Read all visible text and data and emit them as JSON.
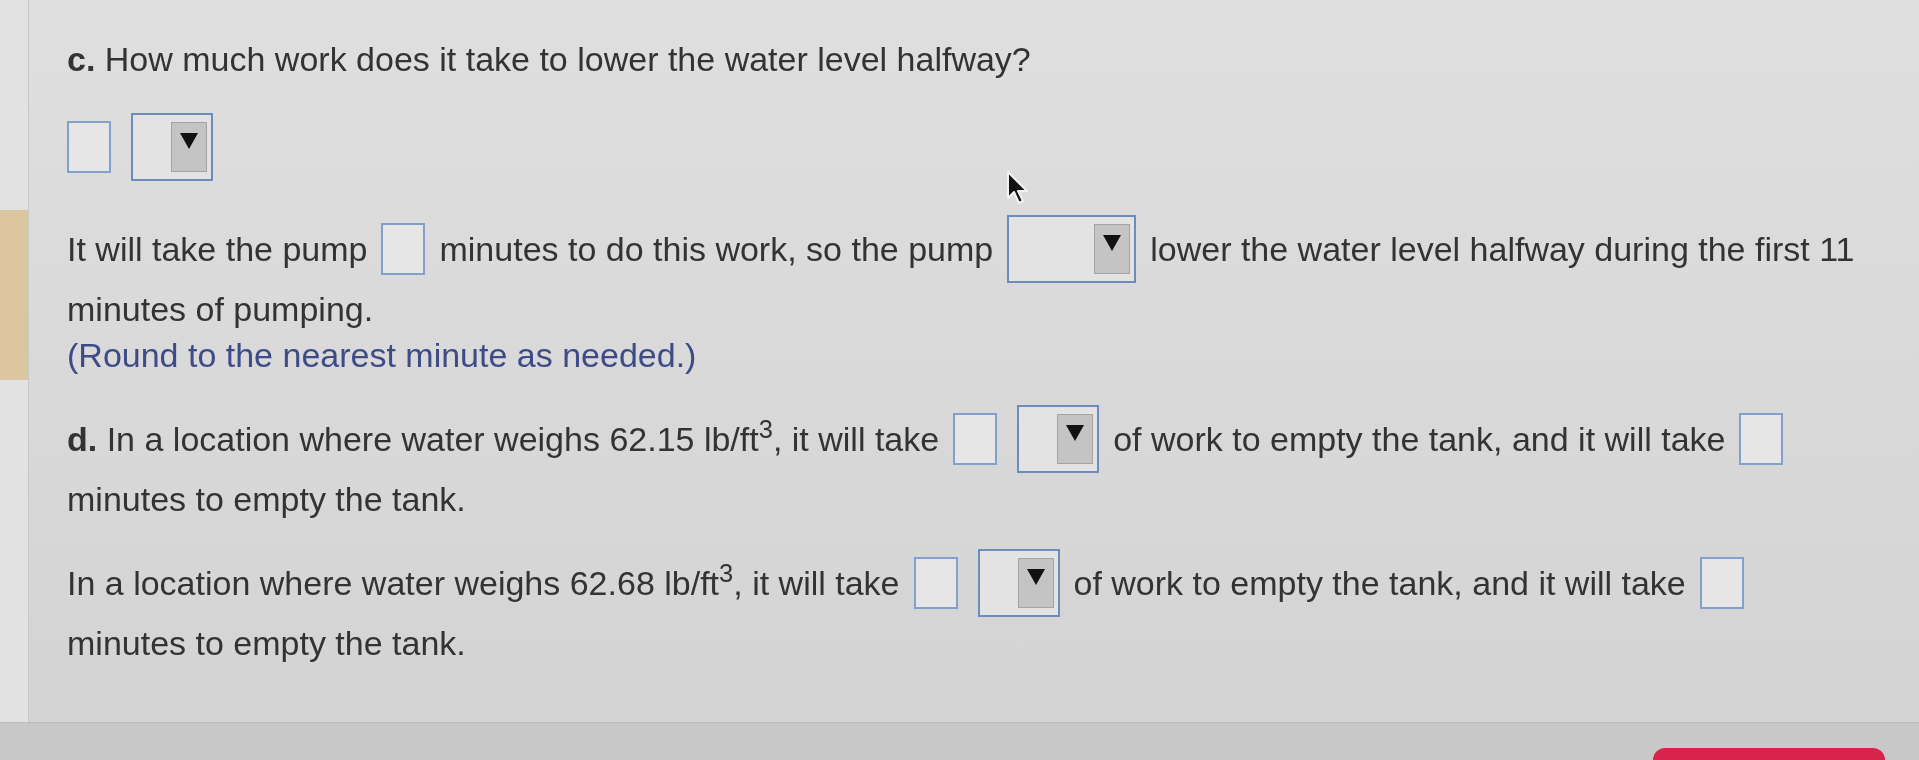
{
  "sections": [
    {
      "lines": [
        [
          {
            "kind": "text",
            "text": "**c.** How much work does it take to lower the water level halfway?"
          }
        ],
        [
          {
            "kind": "input"
          },
          {
            "kind": "dropdown"
          }
        ],
        [
          {
            "kind": "text",
            "text": "It will take the pump"
          },
          {
            "kind": "input"
          },
          {
            "kind": "text",
            "text": "minutes to do this work, so the pump"
          },
          {
            "kind": "widedropdown"
          },
          {
            "kind": "text",
            "text": "lower the water level halfway during the first 11"
          }
        ],
        [
          {
            "kind": "text",
            "text": "minutes of pumping."
          }
        ],
        [
          {
            "kind": "note",
            "text": "(Round to the nearest minute as needed.)"
          }
        ]
      ]
    },
    {
      "lines": [
        [
          {
            "kind": "text",
            "text": "**d.** In a location where water weighs 62.15 lb/ft$^{3}$, it will take"
          },
          {
            "kind": "input"
          },
          {
            "kind": "dropdown"
          },
          {
            "kind": "text",
            "text": "of work to empty the tank, and it will take"
          },
          {
            "kind": "input"
          }
        ],
        [
          {
            "kind": "text",
            "text": "minutes to empty the tank."
          }
        ]
      ]
    },
    {
      "lines": [
        [
          {
            "kind": "text",
            "text": "In a location where water weighs 62.68 lb/ft$^{3}$, it will take"
          },
          {
            "kind": "input"
          },
          {
            "kind": "dropdown"
          },
          {
            "kind": "text",
            "text": "of work to empty the tank, and it will take"
          },
          {
            "kind": "input"
          }
        ],
        [
          {
            "kind": "text",
            "text": "minutes to empty the tank."
          }
        ]
      ]
    }
  ]
}
